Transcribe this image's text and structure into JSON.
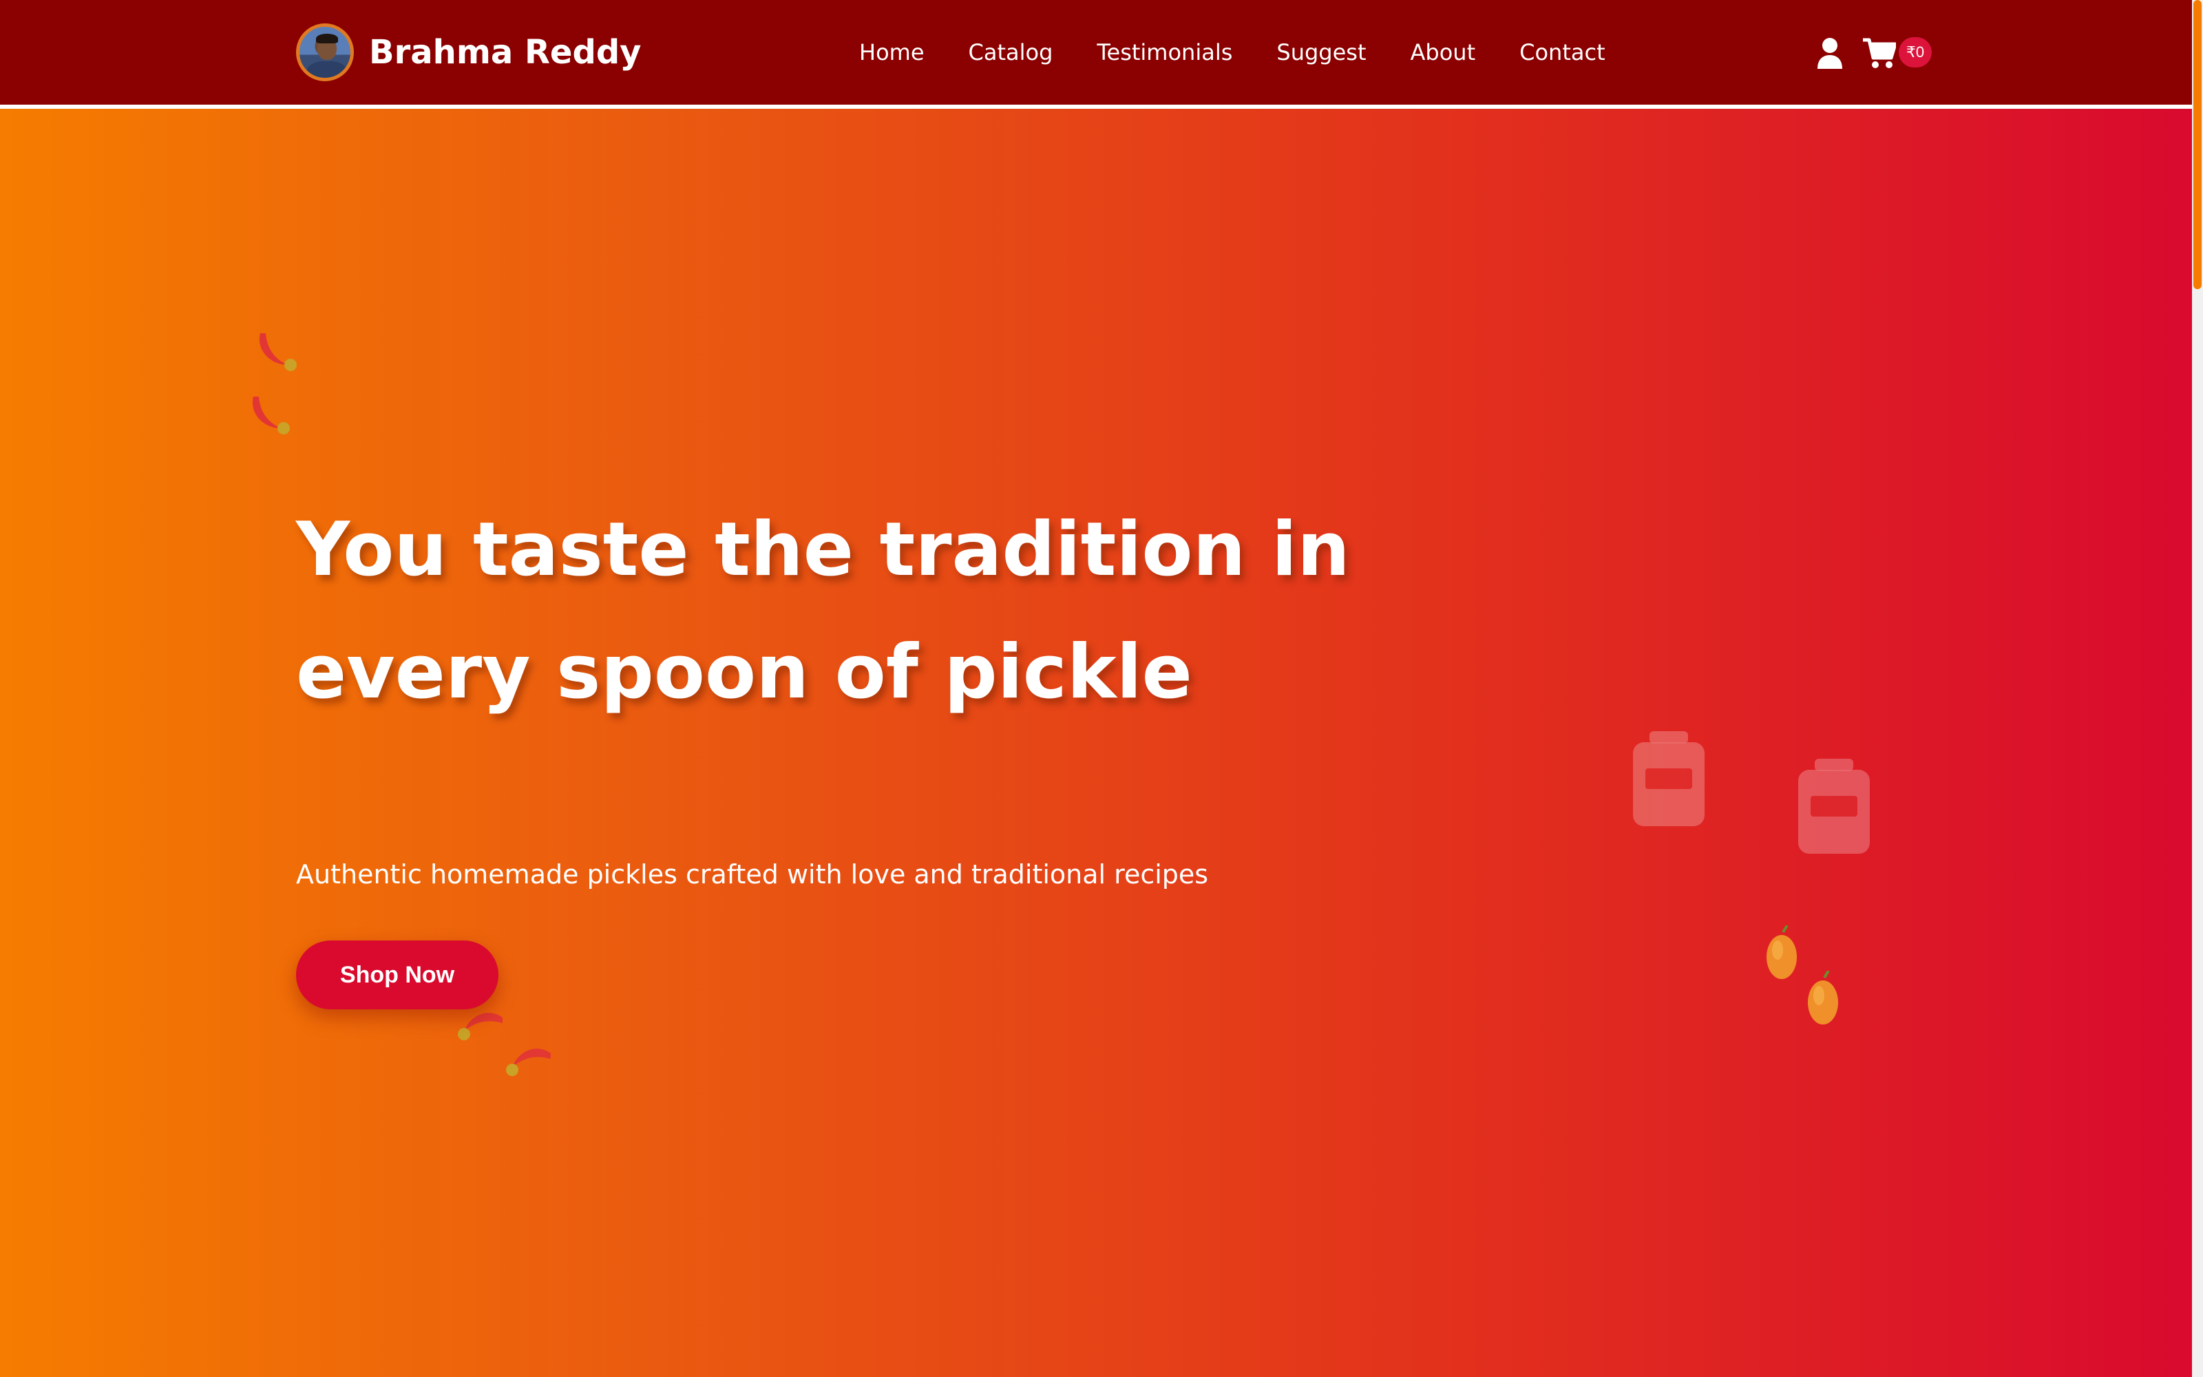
{
  "header": {
    "brand_name": "Brahma Reddy",
    "nav": [
      {
        "label": "Home"
      },
      {
        "label": "Catalog"
      },
      {
        "label": "Testimonials"
      },
      {
        "label": "Suggest"
      },
      {
        "label": "About"
      },
      {
        "label": "Contact"
      }
    ],
    "cart_count": "₹0",
    "icons": {
      "user": "user-icon",
      "cart": "cart-icon"
    }
  },
  "hero": {
    "title": "You taste the tradition in every spoon of pickle",
    "subtitle": "Authentic homemade pickles crafted with love and traditional recipes",
    "cta_label": "Shop Now"
  },
  "colors": {
    "navbar": "#8b0000",
    "gradient_start": "#f57c00",
    "gradient_end": "#d90a2e",
    "accent": "#dc143c"
  }
}
